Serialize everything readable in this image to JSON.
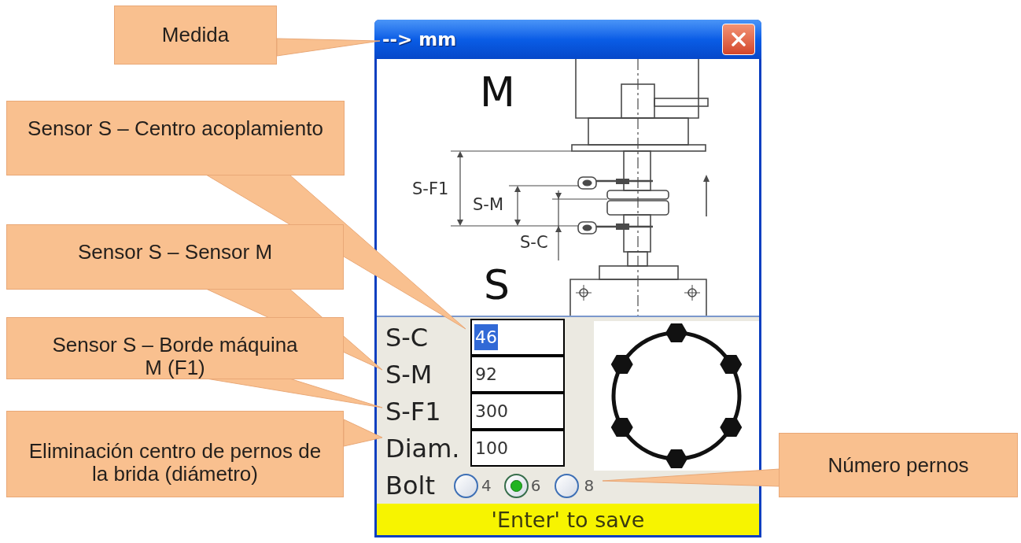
{
  "callouts": [
    "Medida",
    "Sensor S – Centro acoplamiento",
    "Sensor S – Sensor M",
    "Sensor S – Borde máquina M (F1)",
    "Eliminación centro de pernos de la brida (diámetro)",
    "Número pernos"
  ],
  "window": {
    "title": "--> mm"
  },
  "diagram": {
    "machine_labels": [
      "M",
      "S"
    ],
    "dimension_labels": [
      "S-F1",
      "S-M",
      "S-C"
    ]
  },
  "fields": [
    {
      "label": "S-C",
      "value": "46",
      "selected": true
    },
    {
      "label": "S-M",
      "value": "92",
      "selected": false
    },
    {
      "label": "S-F1",
      "value": "300",
      "selected": false
    },
    {
      "label": "Diam.",
      "value": "100",
      "selected": false
    }
  ],
  "bolt": {
    "label": "Bolt",
    "options": [
      {
        "label": "4",
        "selected": false
      },
      {
        "label": "6",
        "selected": true
      },
      {
        "label": "8",
        "selected": false
      }
    ]
  },
  "status_bar": "'Enter' to save"
}
